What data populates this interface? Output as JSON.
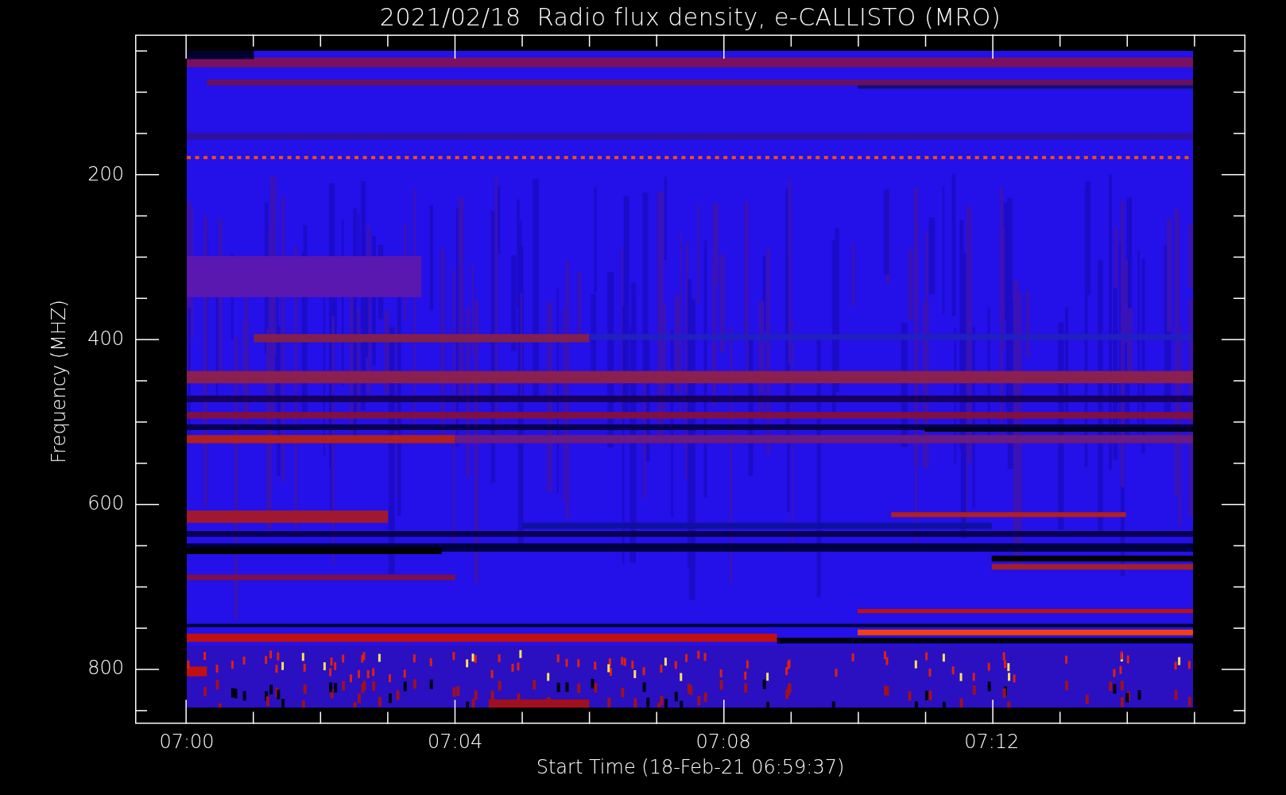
{
  "title": "2021/02/18  Radio flux density, e-CALLISTO (MRO)",
  "y_axis": {
    "label": "Frequency (MHZ)",
    "ticks": [
      "200",
      "400",
      "600",
      "800"
    ]
  },
  "x_axis": {
    "label": "Start Time (18-Feb-21 06:59:37)",
    "ticks": [
      "07:00",
      "07:04",
      "07:08",
      "07:12"
    ]
  }
}
